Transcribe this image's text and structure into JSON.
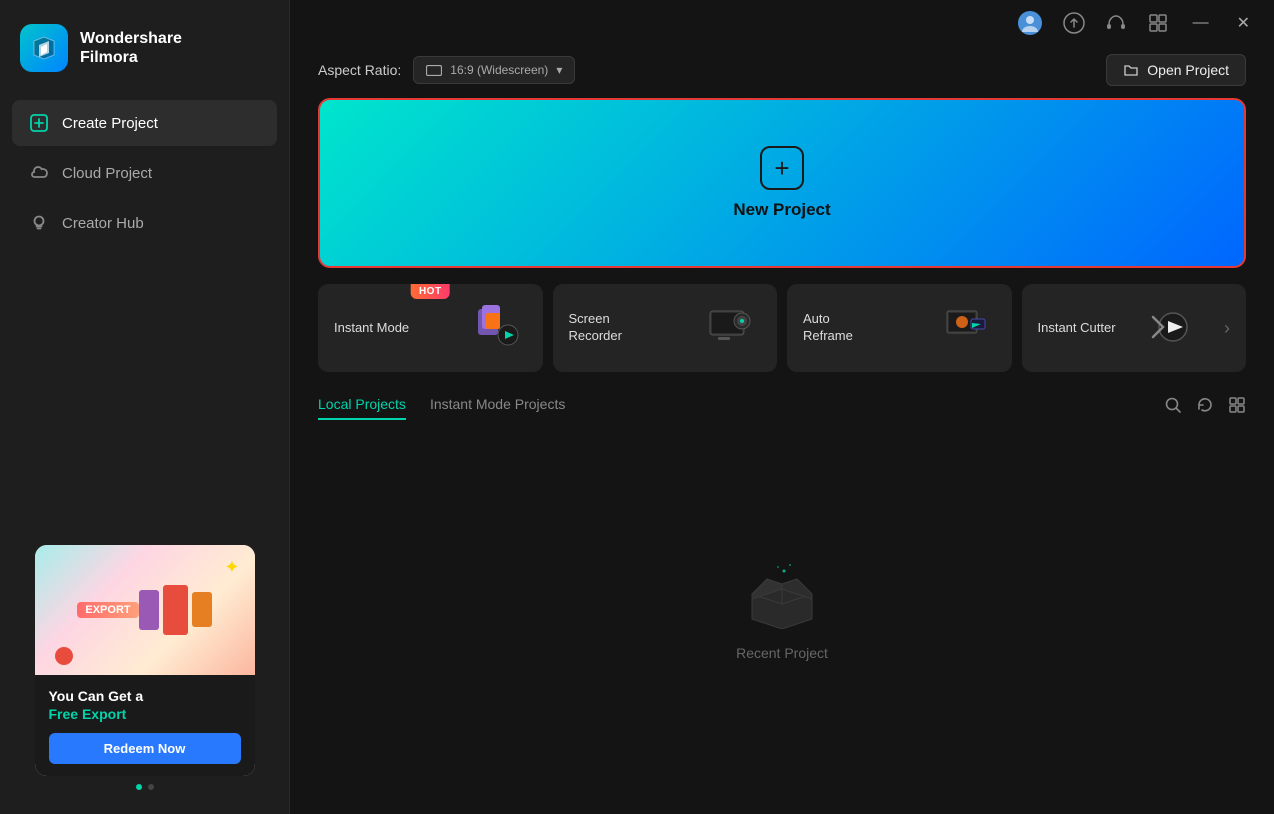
{
  "app": {
    "title": "Wondershare Filmora"
  },
  "topbar": {
    "icons": [
      "avatar",
      "upload",
      "headset",
      "grid",
      "minimize",
      "close"
    ]
  },
  "sidebar": {
    "logo_line1": "Wondershare",
    "logo_line2": "Filmora",
    "nav_items": [
      {
        "id": "create-project",
        "label": "Create Project",
        "active": true
      },
      {
        "id": "cloud-project",
        "label": "Cloud Project",
        "active": false
      },
      {
        "id": "creator-hub",
        "label": "Creator Hub",
        "active": false
      }
    ],
    "ad": {
      "export_badge": "Export",
      "title_line1": "You Can Get a",
      "title_line2": "Free Export",
      "button_label": "Redeem Now"
    }
  },
  "header": {
    "aspect_ratio_label": "Aspect Ratio:",
    "aspect_ratio_value": "16:9 (Widescreen)",
    "open_project_label": "Open Project"
  },
  "new_project": {
    "label": "New Project"
  },
  "tools": [
    {
      "id": "instant-mode",
      "label": "Instant Mode",
      "hot": true
    },
    {
      "id": "screen-recorder",
      "label": "Screen Recorder",
      "hot": false
    },
    {
      "id": "auto-reframe",
      "label": "Auto Reframe",
      "hot": false
    },
    {
      "id": "instant-cutter",
      "label": "Instant Cutter",
      "hot": false
    }
  ],
  "projects_tabs": [
    {
      "id": "local",
      "label": "Local Projects",
      "active": true
    },
    {
      "id": "instant-mode",
      "label": "Instant Mode Projects",
      "active": false
    }
  ],
  "empty_state": {
    "label": "Recent Project"
  },
  "colors": {
    "accent": "#00d4aa",
    "brand_gradient_start": "#00e5cc",
    "brand_gradient_end": "#0066ff",
    "active_nav_bg": "#2d2d2d",
    "hot_badge": "#ff3b6b",
    "banner_border": "#e53935",
    "ad_button": "#2979ff"
  }
}
